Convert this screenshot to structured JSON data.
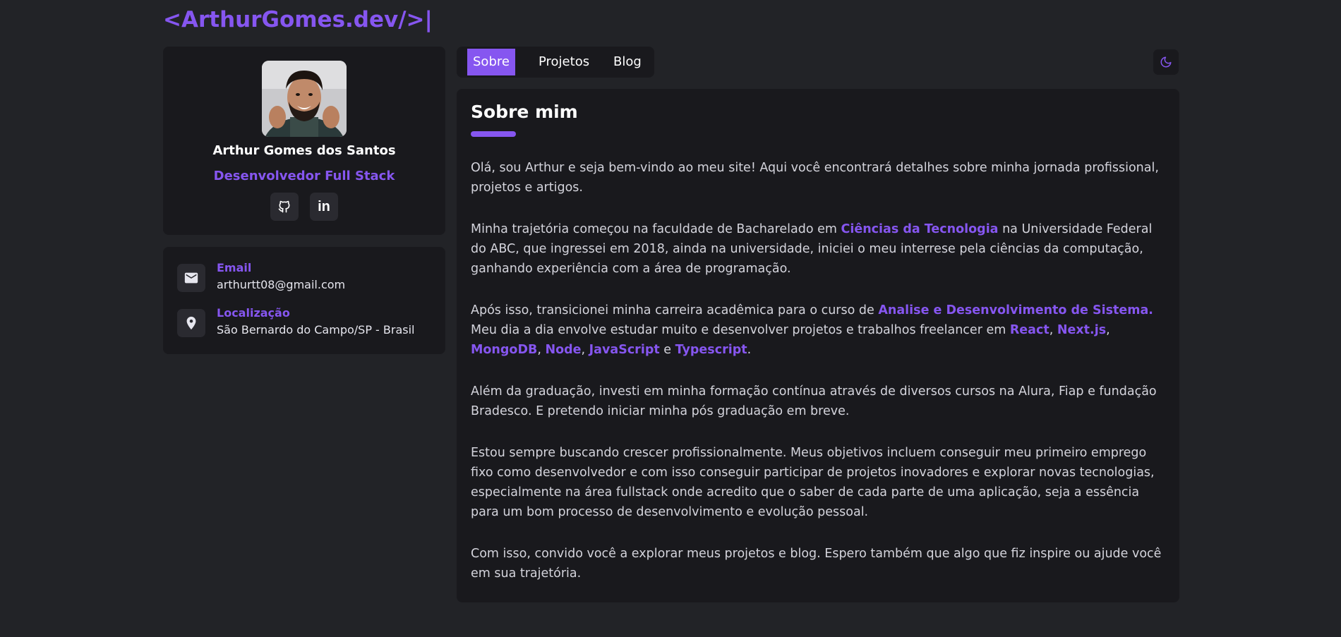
{
  "header": {
    "logo_text": "<ArthurGomes.dev/>|"
  },
  "profile": {
    "name": "Arthur Gomes dos Santos",
    "role": "Desenvolvedor Full Stack",
    "social": [
      {
        "icon": "github-icon"
      },
      {
        "icon": "linkedin-icon",
        "glyph": "in"
      }
    ]
  },
  "contact": {
    "email_label": "Email",
    "email_value": "arthurtt08@gmail.com",
    "location_label": "Localização",
    "location_value": "São Bernardo do Campo/SP - Brasil"
  },
  "tabs": [
    {
      "label": "Sobre",
      "active": true
    },
    {
      "label": "Projetos",
      "active": false
    },
    {
      "label": "Blog",
      "active": false
    }
  ],
  "theme_toggle": {
    "icon": "moon-icon"
  },
  "about": {
    "title": "Sobre mim",
    "p1": "Olá, sou Arthur e seja bem-vindo ao meu site! Aqui você encontrará detalhes sobre minha jornada profissional, projetos e artigos.",
    "p2_a": "Minha trajetória começou na faculdade de Bacharelado em ",
    "p2_hl": "Ciências da Tecnologia",
    "p2_b": " na Universidade Federal do ABC, que ingressei em 2018, ainda na universidade, iniciei o meu interrese pela ciências da computação, ganhando experiência com a área de programação.",
    "p3_a": "Após isso, transicionei minha carreira acadêmica para o curso de ",
    "p3_hl1": "Analise e Desenvolvimento de Sistema.",
    "p3_b": " Meu dia a dia envolve estudar muito e desenvolver projetos e trabalhos freelancer em ",
    "tech": [
      "React",
      "Next.js",
      "MongoDB",
      "Node",
      "JavaScript",
      "Typescript"
    ],
    "sep_comma": ", ",
    "sep_e": " e ",
    "p3_end": ".",
    "p4": "Além da graduação, investi em minha formação contínua através de diversos cursos na Alura, Fiap e fundação Bradesco. E pretendo iniciar minha pós graduação em breve.",
    "p5": "Estou sempre buscando crescer profissionalmente. Meus objetivos incluem conseguir meu primeiro emprego fixo como desenvolvedor e com isso conseguir participar de projetos inovadores e explorar novas tecnologias, especialmente na área fullstack onde acredito que o saber de cada parte de uma aplicação, seja a essência para um bom processo de desenvolvimento e evolução pessoal.",
    "p6": "Com isso, convido você a explorar meus projetos e blog. Espero também que algo que fiz inspire ou ajude você em sua trajetória."
  },
  "colors": {
    "accent": "#8656f0",
    "background": "#222327",
    "card": "#19191d"
  }
}
